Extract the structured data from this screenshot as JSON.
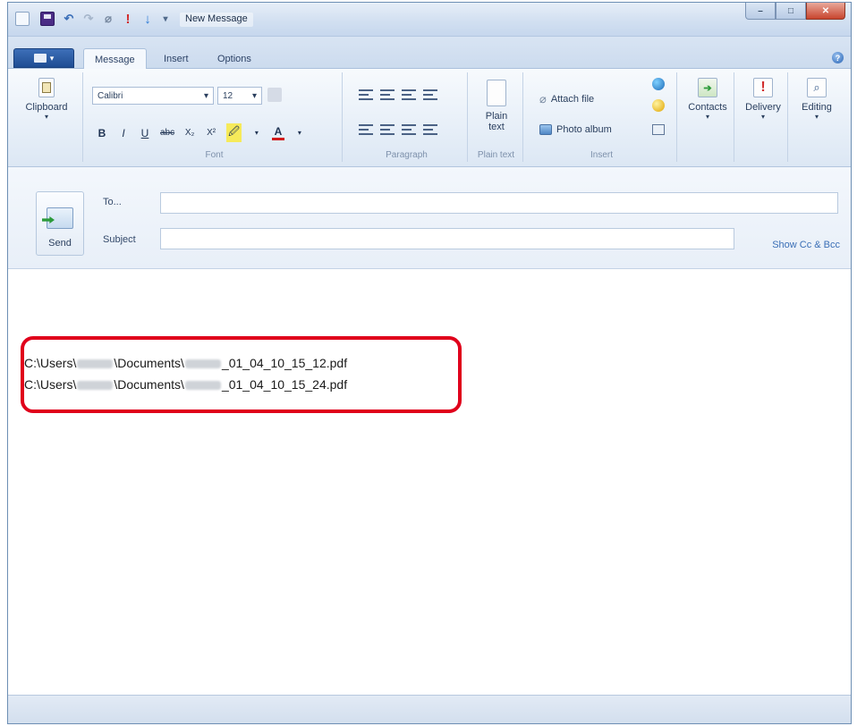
{
  "window": {
    "title": "New Message",
    "buttons": {
      "minimize": "–",
      "maximize": "□",
      "close": "✕"
    }
  },
  "quick_access": [
    "document-icon",
    "save-icon",
    "undo-icon",
    "redo-icon",
    "attach-icon",
    "high-priority-icon",
    "low-priority-icon",
    "customize-icon"
  ],
  "tabs": {
    "menu_label": "▾",
    "items": [
      "Message",
      "Insert",
      "Options"
    ],
    "active": "Message"
  },
  "ribbon": {
    "clipboard": {
      "label": "Clipboard"
    },
    "font": {
      "group_label": "Font",
      "family": "Calibri",
      "size": "12",
      "format_buttons": [
        "B",
        "I",
        "U",
        "abc",
        "X₂",
        "X²",
        "🖉",
        "A"
      ]
    },
    "paragraph": {
      "group_label": "Paragraph"
    },
    "plain_text": {
      "label_line1": "Plain",
      "label_line2": "text",
      "group_label": "Plain text"
    },
    "insert": {
      "group_label": "Insert",
      "attach_file": "Attach file",
      "photo_album": "Photo album"
    },
    "contacts": {
      "label": "Contacts"
    },
    "delivery": {
      "label": "Delivery"
    },
    "editing": {
      "label": "Editing"
    }
  },
  "compose": {
    "send_label": "Send",
    "to_label": "To...",
    "subject_label": "Subject",
    "to_value": "",
    "subject_value": "",
    "show_cc_bcc": "Show Cc & Bcc"
  },
  "attachments": [
    {
      "prefix": "C:\\Users\\",
      "middle": "\\Documents\\",
      "suffix": "_01_04_10_15_12.pdf"
    },
    {
      "prefix": "C:\\Users\\",
      "middle": "\\Documents\\",
      "suffix": "_01_04_10_15_24.pdf"
    }
  ],
  "colors": {
    "highlight": "#e0001b",
    "accent": "#3a6eb6"
  }
}
